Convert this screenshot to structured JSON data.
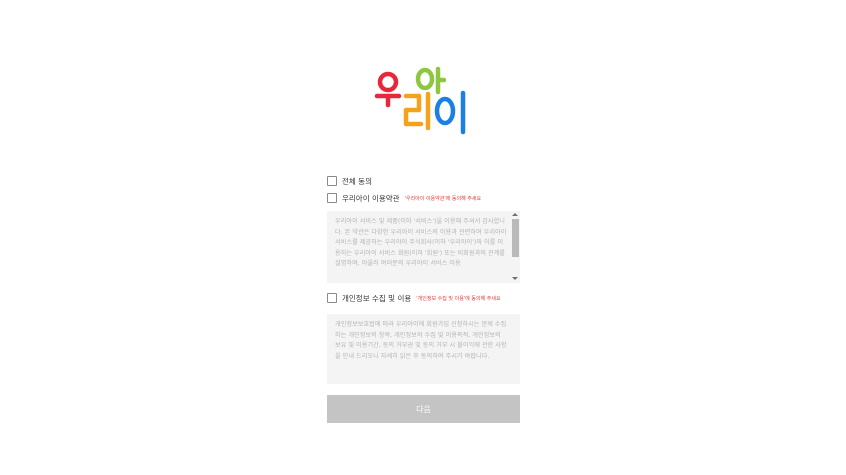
{
  "logo": {
    "text": "우리아이",
    "colors": {
      "u": "#e8283a",
      "ri": "#f5a21b",
      "a": "#8dc63f",
      "i": "#1b7fe6"
    }
  },
  "agree_all": {
    "label": "전체 동의"
  },
  "terms": {
    "label": "우리아이 이용약관",
    "warning": "'우리아이 이용약관'에 동의해 주세요",
    "text": "우리아이 서비스 및 제품(이하 '서비스')을 이용해 주셔서 감사합니다. 본 약관은 다양한 우리아이 서비스의 이용과 관련하여 우리아이 서비스를 제공하는 우리아이 주식회사(이하 '우리아이')와 이를 이용하는 우리아이 서비스 회원(이하 '회원') 또는 비회원과의 관계를 설명하며, 아울러 여러분의 우리아이 서비스 이용"
  },
  "privacy": {
    "label": "개인정보 수집 및 이용",
    "warning": "'개인정보 수집 및 이용'에 동의해 주세요",
    "text": "개인정보보호법에 따라 우리아이에 회원가입 신청하시는 분께 수집하는 개인정보의 항목, 개인정보의 수집 및 이용목적, 개인정보의 보유 및 이용기간, 동의 거부권 및 동의 거부 시 불이익에 관한 사항을 안내 드리오니 자세히 읽은 후 동의하여 주시기 바랍니다."
  },
  "next_button": {
    "label": "다음"
  },
  "colors": {
    "warning": "#e03a3a",
    "button_disabled": "#c4c4c4",
    "textbox_bg": "#f4f4f4"
  }
}
